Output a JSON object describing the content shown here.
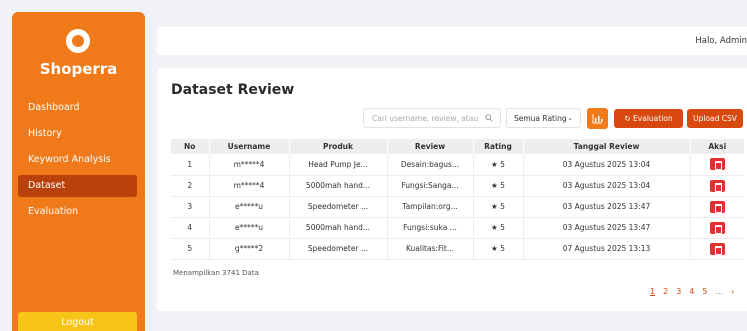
{
  "app": {
    "brand": "Shoperra",
    "accent": "#f07a1a",
    "danger": "#e03131"
  },
  "sidebar": {
    "items": [
      {
        "label": "Dashboard",
        "active": false
      },
      {
        "label": "History",
        "active": false
      },
      {
        "label": "Keyword Analysis",
        "active": false
      },
      {
        "label": "Dataset",
        "active": true
      },
      {
        "label": "Evaluation",
        "active": false
      }
    ],
    "logout_label": "Logout"
  },
  "header": {
    "greeting": "Halo, Admin"
  },
  "main": {
    "title": "Dataset Review",
    "search": {
      "placeholder": "Cari username, review, atau"
    },
    "rating_filter": {
      "selected": "Semua Rating"
    },
    "chart_button_icon": "bar-chart-icon",
    "evaluation_button": "Evaluation",
    "upload_button": "Upload CSV",
    "table": {
      "columns": [
        "No",
        "Username",
        "Produk",
        "Review",
        "Rating",
        "Tanggal Review",
        "Aksi"
      ],
      "rows": [
        {
          "no": "1",
          "username": "m*****4",
          "produk": "Head Pump Je...",
          "review": "Desain:bagus...",
          "rating": "★ 5",
          "tanggal": "03 Agustus 2025 13:04"
        },
        {
          "no": "2",
          "username": "m*****4",
          "produk": "5000mah hand...",
          "review": "Fungsi:Sanga...",
          "rating": "★ 5",
          "tanggal": "03 Agustus 2025 13:04"
        },
        {
          "no": "3",
          "username": "e*****u",
          "produk": "Speedometer ...",
          "review": "Tampilan:org...",
          "rating": "★ 5",
          "tanggal": "03 Agustus 2025 13:47"
        },
        {
          "no": "4",
          "username": "e*****u",
          "produk": "5000mah hand...",
          "review": "Fungsi:suka ...",
          "rating": "★ 5",
          "tanggal": "03 Agustus 2025 13:47"
        },
        {
          "no": "5",
          "username": "g*****2",
          "produk": "Speedometer ...",
          "review": "Kualitas:Fit...",
          "rating": "★ 5",
          "tanggal": "07 Agustus 2025 13:13"
        }
      ]
    },
    "summary": "Menampilkan 3741 Data",
    "pagination": {
      "pages": [
        "1",
        "2",
        "3",
        "4",
        "5"
      ],
      "current": "1",
      "ellipsis": "...",
      "next": "›"
    }
  }
}
